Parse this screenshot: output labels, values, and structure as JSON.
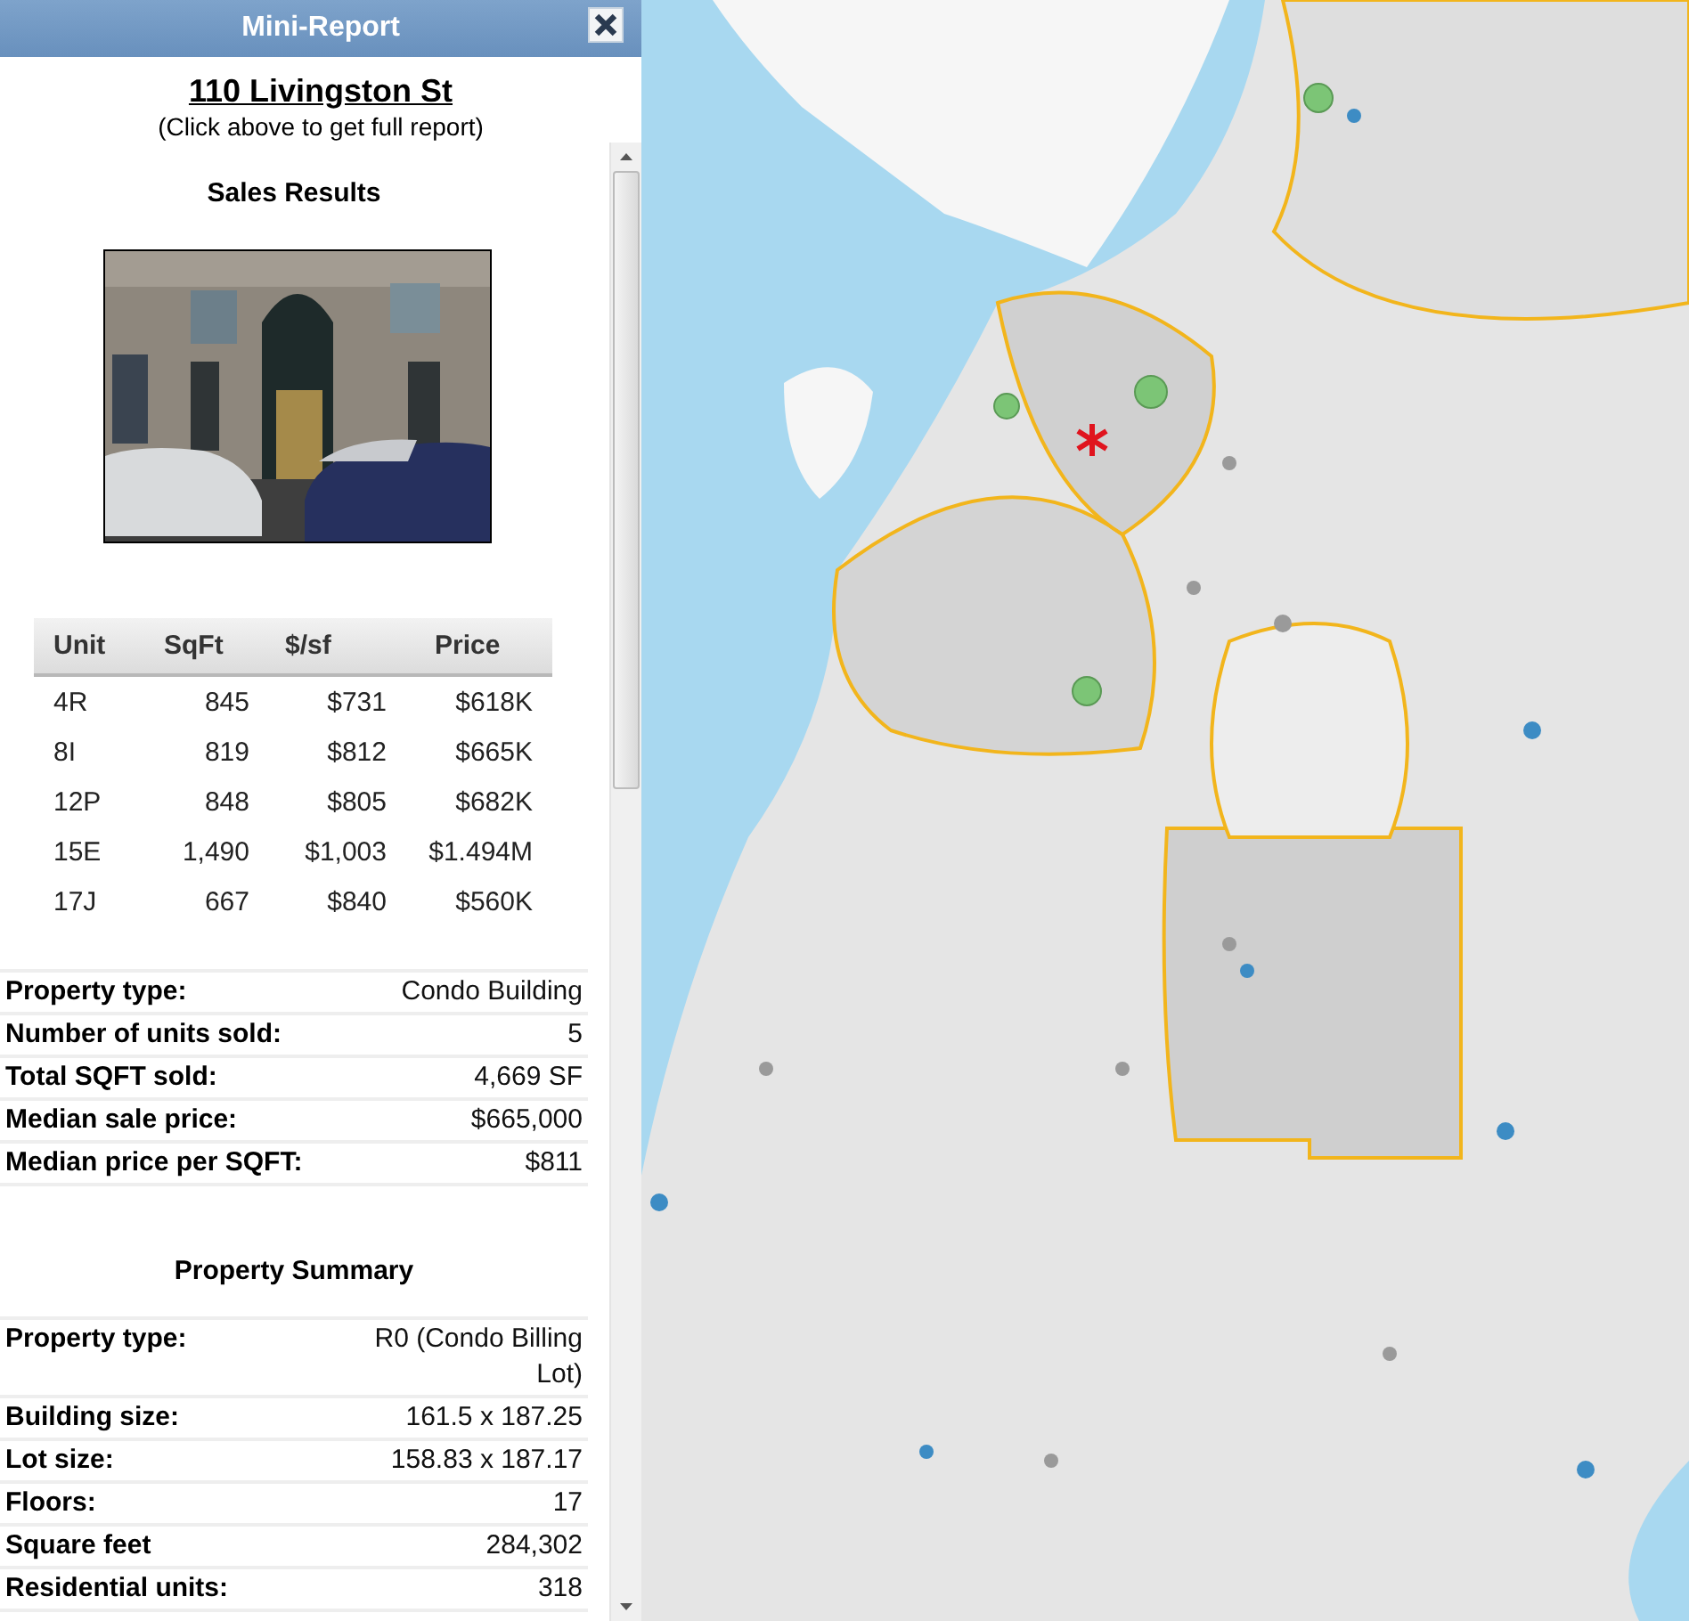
{
  "panel": {
    "title": "Mini-Report"
  },
  "address": "110 Livingston St",
  "hint": "(Click above to get full report)",
  "sales": {
    "heading": "Sales Results",
    "table": {
      "columns": [
        "Unit",
        "SqFt",
        "$/sf",
        "Price"
      ],
      "rows": [
        [
          "4R",
          "845",
          "$731",
          "$618K"
        ],
        [
          "8I",
          "819",
          "$812",
          "$665K"
        ],
        [
          "12P",
          "848",
          "$805",
          "$682K"
        ],
        [
          "15E",
          "1,490",
          "$1,003",
          "$1.494M"
        ],
        [
          "17J",
          "667",
          "$840",
          "$560K"
        ]
      ]
    },
    "details": [
      {
        "label": "Property type:",
        "value": "Condo Building"
      },
      {
        "label": "Number of units sold:",
        "value": "5"
      },
      {
        "label": "Total SQFT sold:",
        "value": "4,669 SF"
      },
      {
        "label": "Median sale price:",
        "value": "$665,000"
      },
      {
        "label": "Median price per SQFT:",
        "value": "$811"
      }
    ]
  },
  "summary": {
    "heading": "Property Summary",
    "details": [
      {
        "label": "Property type:",
        "value": "R0 (Condo Billing Lot)"
      },
      {
        "label": "Building size:",
        "value": "161.5 x 187.25"
      },
      {
        "label": "Lot size:",
        "value": "158.83 x 187.17"
      },
      {
        "label": "Floors:",
        "value": "17"
      },
      {
        "label": "Square feet",
        "value": "284,302"
      },
      {
        "label": "Residential units:",
        "value": "318"
      }
    ]
  }
}
